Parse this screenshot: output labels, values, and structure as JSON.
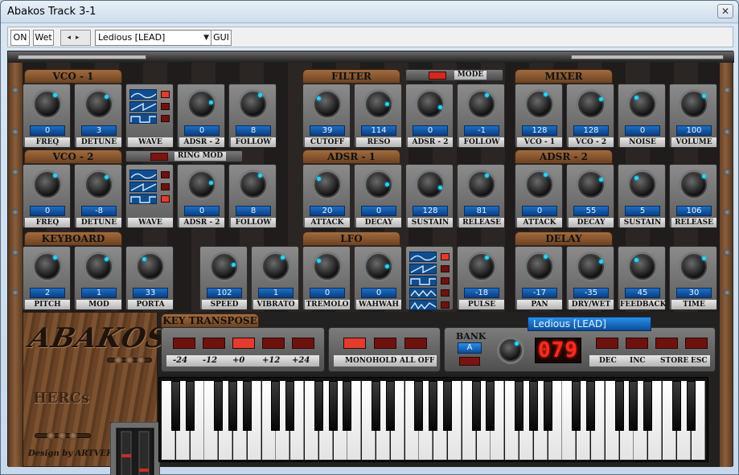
{
  "window": {
    "title": "Abakos  Track 3-1",
    "close_glyph": "✕"
  },
  "toolbar": {
    "on_label": "ON",
    "wet_label": "Wet",
    "arrows": "◂▸",
    "preset_value": "Ledious [LEAD]",
    "dropdown_glyph": "▼",
    "gui_label": "GUI"
  },
  "sections": {
    "vco1": "VCO - 1",
    "vco2": "VCO - 2",
    "filter": "FILTER",
    "mixer": "MIXER",
    "adsr1": "ADSR - 1",
    "adsr2": "ADSR - 2",
    "keyboard": "KEYBOARD",
    "lfo": "LFO",
    "delay": "DELAY",
    "key_transpose": "KEY TRANSPOSE"
  },
  "mode_label": "MODE",
  "ring_mod_label": "RING MOD",
  "rows": [
    [
      {
        "label": "FREQ",
        "value": "0"
      },
      {
        "label": "DETUNE",
        "value": "3"
      },
      {
        "label": "WAVE",
        "value": null
      },
      {
        "label": "ADSR - 2",
        "value": "0"
      },
      {
        "label": "FOLLOW",
        "value": "8"
      },
      {
        "label": "CUTOFF",
        "value": "39"
      },
      {
        "label": "RESO",
        "value": "114"
      },
      {
        "label": "ADSR - 2",
        "value": "0"
      },
      {
        "label": "FOLLOW",
        "value": "-1"
      },
      {
        "label": "VCO - 1",
        "value": "128"
      },
      {
        "label": "VCO - 2",
        "value": "128"
      },
      {
        "label": "NOISE",
        "value": "0"
      },
      {
        "label": "VOLUME",
        "value": "100"
      }
    ],
    [
      {
        "label": "FREQ",
        "value": "0"
      },
      {
        "label": "DETUNE",
        "value": "-8"
      },
      {
        "label": "WAVE",
        "value": null
      },
      {
        "label": "ADSR - 2",
        "value": "0"
      },
      {
        "label": "FOLLOW",
        "value": "8"
      },
      {
        "label": "ATTACK",
        "value": "20"
      },
      {
        "label": "DECAY",
        "value": "0"
      },
      {
        "label": "SUSTAIN",
        "value": "128"
      },
      {
        "label": "RELEASE",
        "value": "81"
      },
      {
        "label": "ATTACK",
        "value": "0"
      },
      {
        "label": "DECAY",
        "value": "55"
      },
      {
        "label": "SUSTAIN",
        "value": "5"
      },
      {
        "label": "RELEASE",
        "value": "106"
      }
    ],
    [
      {
        "label": "PITCH",
        "value": "2"
      },
      {
        "label": "MOD",
        "value": "1"
      },
      {
        "label": "PORTA",
        "value": "33"
      },
      {
        "label": "SPEED",
        "value": "102"
      },
      {
        "label": "VIBRATO",
        "value": "1"
      },
      {
        "label": "TREMOLO",
        "value": "0"
      },
      {
        "label": "WAHWAH",
        "value": "0"
      },
      {
        "label": "WAVE",
        "value": null
      },
      {
        "label": "PULSE",
        "value": "-18"
      },
      {
        "label": "PAN",
        "value": "-17"
      },
      {
        "label": "DRY/WET",
        "value": "-35"
      },
      {
        "label": "FEEDBACK",
        "value": "45"
      },
      {
        "label": "TIME",
        "value": "30"
      }
    ]
  ],
  "transpose": [
    "-24",
    "-12",
    "+0",
    "+12",
    "+24"
  ],
  "play_modes": [
    "MONO",
    "HOLD",
    "ALL OFF"
  ],
  "bank": {
    "label": "BANK",
    "value": "A"
  },
  "preset_display": "Ledious [LEAD]",
  "preset_number": "079",
  "preset_buttons": [
    "DEC",
    "INC",
    "STORE",
    "ESC"
  ],
  "logo": {
    "main": "ABAKOS",
    "sub": "HERCs",
    "credit": "Design by ARTVERA"
  },
  "colors": {
    "led_on": "#e33b2e",
    "display_blue": "#1d6fc4",
    "indicator": "#29d3ff"
  }
}
